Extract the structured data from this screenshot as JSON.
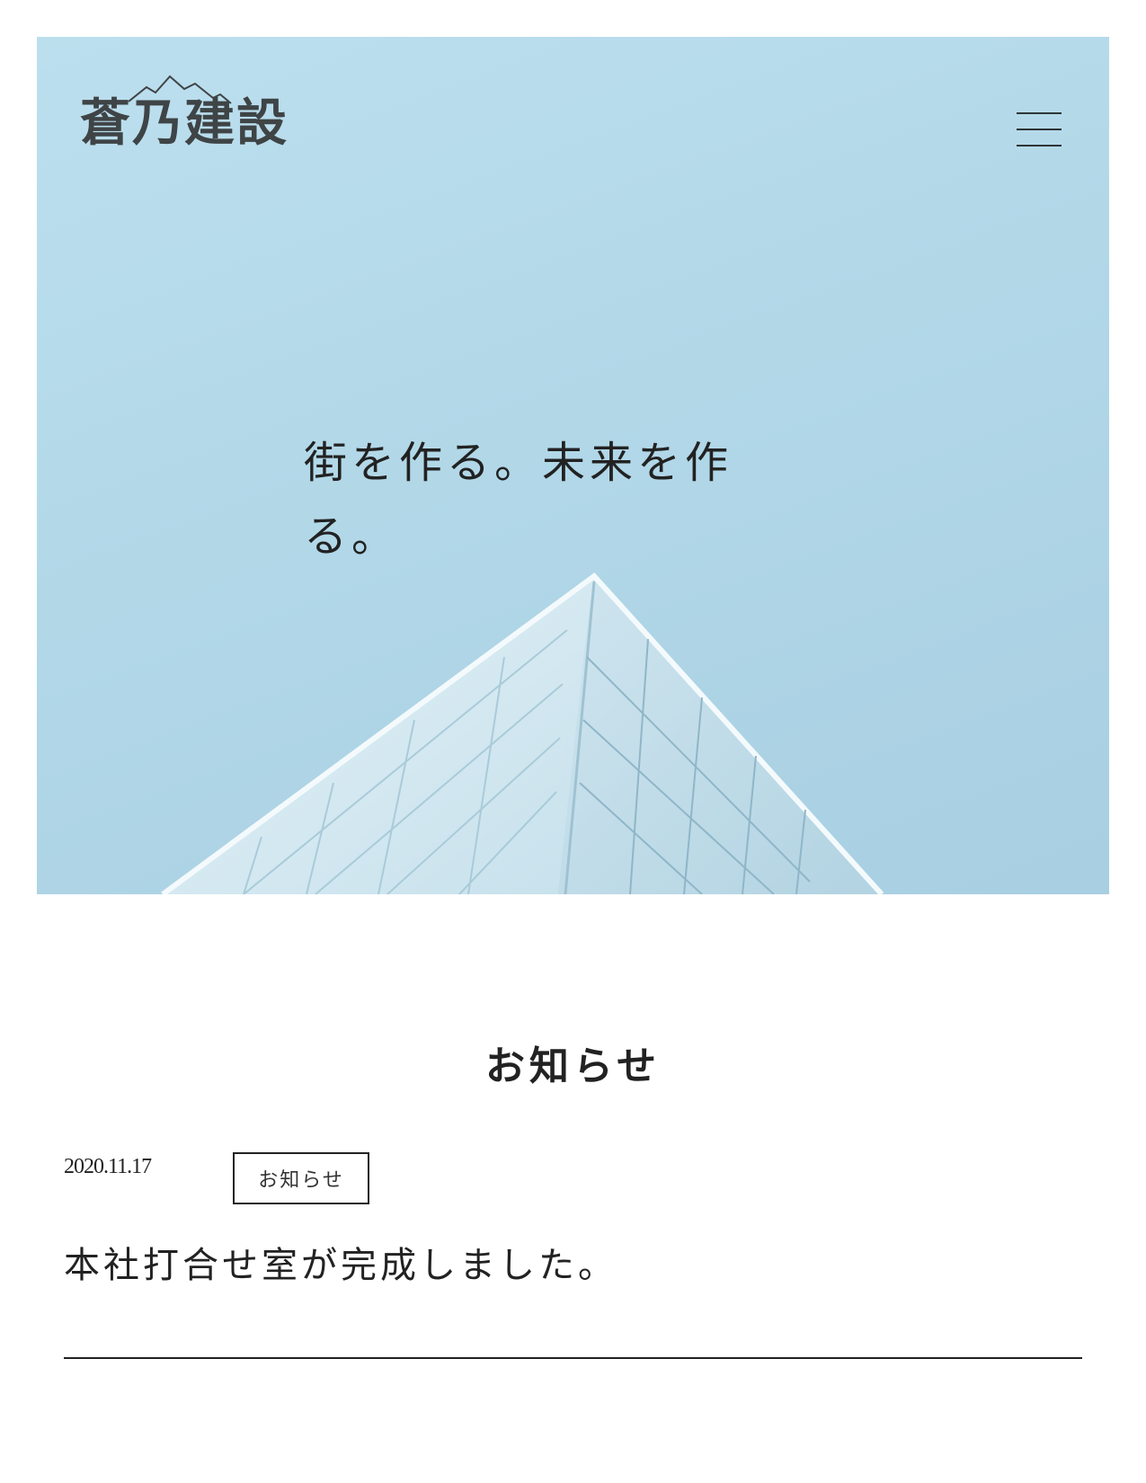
{
  "header": {
    "logo_text": "蒼乃建設",
    "menu_icon": "hamburger-menu-icon"
  },
  "hero": {
    "tagline": "街を作る。未来を作る。"
  },
  "news": {
    "heading": "お知らせ",
    "items": [
      {
        "date": "2020.11.17",
        "category": "お知らせ",
        "title": "本社打合せ室が完成しました。"
      }
    ]
  },
  "colors": {
    "sky": "#b3d9e9",
    "text": "#222222",
    "logo": "#3f4446"
  }
}
